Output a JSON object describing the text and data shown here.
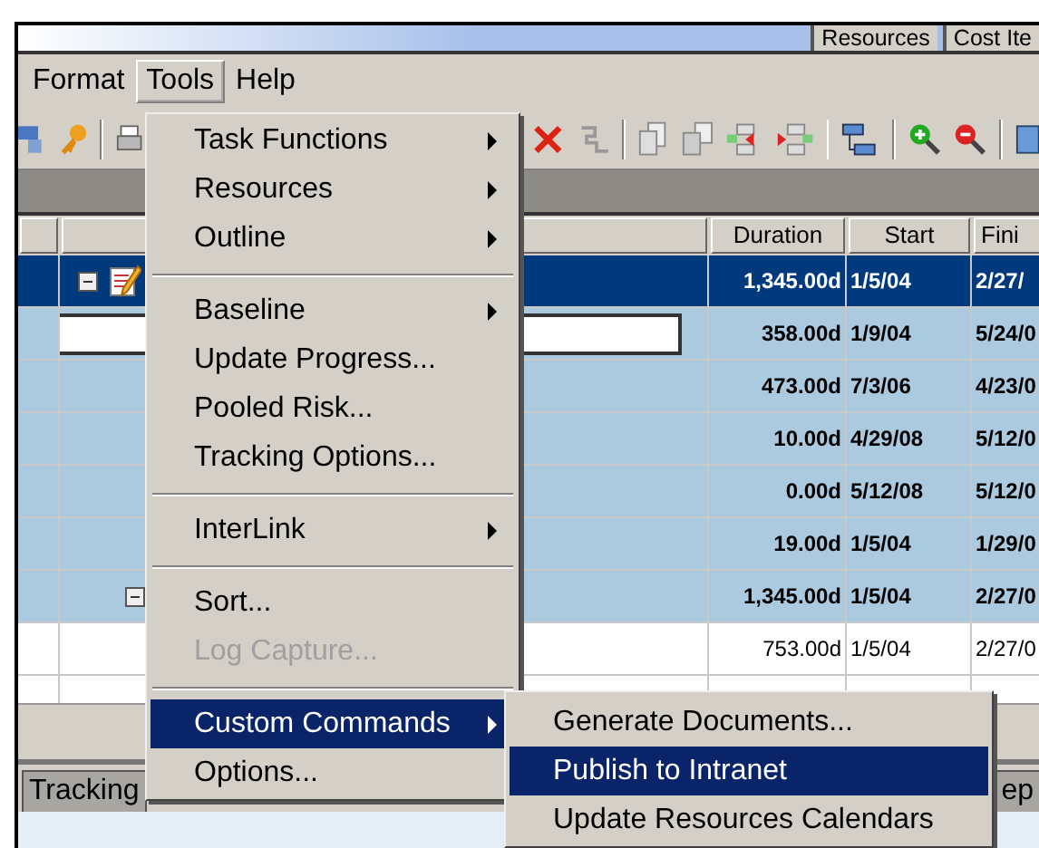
{
  "title_tabs": [
    {
      "label": "Resources"
    },
    {
      "label": "Cost Ite"
    }
  ],
  "menubar": [
    {
      "label": "Format",
      "selected": false
    },
    {
      "label": "Tools",
      "selected": true
    },
    {
      "label": "Help",
      "selected": false
    }
  ],
  "table": {
    "columns": [
      "Duration",
      "Start",
      "Fini"
    ],
    "rows": [
      {
        "kind": "project",
        "selected": true,
        "editing": false,
        "expanded": true,
        "duration": "1,345.00d",
        "start": "1/5/04",
        "finish": "2/27/",
        "children": [
          {
            "kind": "summary",
            "selected": false,
            "editing": true,
            "duration": "358.00d",
            "start": "1/9/04",
            "finish": "5/24/0"
          },
          {
            "kind": "summary",
            "selected": false,
            "editing": false,
            "duration": "473.00d",
            "start": "7/3/06",
            "finish": "4/23/0"
          },
          {
            "kind": "summary",
            "selected": false,
            "editing": false,
            "duration": "10.00d",
            "start": "4/29/08",
            "finish": "5/12/0"
          },
          {
            "kind": "summary",
            "selected": false,
            "editing": false,
            "duration": "0.00d",
            "start": "5/12/08",
            "finish": "5/12/0"
          },
          {
            "kind": "summary",
            "selected": false,
            "editing": false,
            "duration": "19.00d",
            "start": "1/5/04",
            "finish": "1/29/0"
          },
          {
            "kind": "summary",
            "selected": false,
            "editing": false,
            "expanded": true,
            "duration": "1,345.00d",
            "start": "1/5/04",
            "finish": "2/27/0",
            "children": [
              {
                "kind": "task",
                "selected": false,
                "editing": false,
                "duration": "753.00d",
                "start": "1/5/04",
                "finish": "2/27/0"
              }
            ]
          }
        ]
      }
    ]
  },
  "bottom_tabs": [
    {
      "label": "Tracking"
    },
    {
      "label": "ep"
    }
  ],
  "tools_menu": [
    {
      "kind": "submenu",
      "label": "Task Functions",
      "disabled": false,
      "selected": false
    },
    {
      "kind": "submenu",
      "label": "Resources",
      "disabled": false,
      "selected": false
    },
    {
      "kind": "submenu",
      "label": "Outline",
      "disabled": false,
      "selected": false
    },
    {
      "kind": "separator"
    },
    {
      "kind": "submenu",
      "label": "Baseline",
      "disabled": false,
      "selected": false
    },
    {
      "kind": "command",
      "label": "Update Progress...",
      "disabled": false,
      "selected": false
    },
    {
      "kind": "command",
      "label": "Pooled Risk...",
      "disabled": false,
      "selected": false
    },
    {
      "kind": "command",
      "label": "Tracking Options...",
      "disabled": false,
      "selected": false
    },
    {
      "kind": "separator"
    },
    {
      "kind": "submenu",
      "label": "InterLink",
      "disabled": false,
      "selected": false
    },
    {
      "kind": "separator"
    },
    {
      "kind": "command",
      "label": "Sort...",
      "disabled": false,
      "selected": false
    },
    {
      "kind": "command",
      "label": "Log Capture...",
      "disabled": true,
      "selected": false
    },
    {
      "kind": "separator"
    },
    {
      "kind": "submenu",
      "label": "Custom Commands",
      "disabled": false,
      "selected": true
    },
    {
      "kind": "command",
      "label": "Options...",
      "disabled": false,
      "selected": false
    }
  ],
  "custom_commands_menu": [
    {
      "kind": "command",
      "label": "Generate Documents...",
      "disabled": false,
      "selected": false
    },
    {
      "kind": "command",
      "label": "Publish to Intranet",
      "disabled": false,
      "selected": true
    },
    {
      "kind": "command",
      "label": "Update Resources Calendars",
      "disabled": false,
      "selected": false
    }
  ]
}
